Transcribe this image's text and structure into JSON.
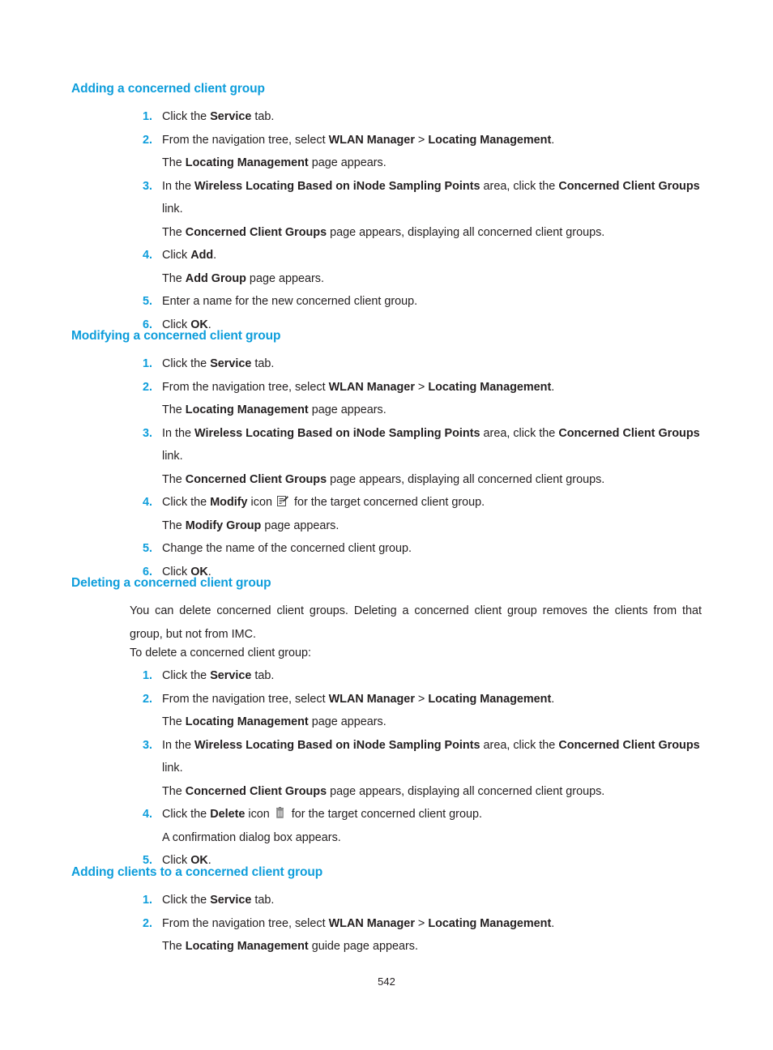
{
  "document": {
    "page_number": "542",
    "accent_color": "#0d9ddb",
    "text_color": "#231f20"
  },
  "sections": {
    "adding": {
      "heading": "Adding a concerned client group",
      "steps": {
        "n1": "1.",
        "s1_a": "Click the ",
        "s1_b": "Service",
        "s1_c": " tab.",
        "n2": "2.",
        "s2_a": "From the navigation tree, select ",
        "s2_b": "WLAN Manager",
        "s2_c": " > ",
        "s2_d": "Locating Management",
        "s2_e": ".",
        "s2_sub_a": "The ",
        "s2_sub_b": "Locating Management",
        "s2_sub_c": " page appears.",
        "n3": "3.",
        "s3_a": "In the ",
        "s3_b": "Wireless Locating Based on iNode Sampling Points",
        "s3_c": " area, click the ",
        "s3_d": "Concerned Client Groups",
        "s3_e": " link.",
        "s3_sub_a": "The ",
        "s3_sub_b": "Concerned Client Groups",
        "s3_sub_c": " page appears, displaying all concerned client groups.",
        "n4": "4.",
        "s4_a": "Click ",
        "s4_b": "Add",
        "s4_c": ".",
        "s4_sub_a": "The ",
        "s4_sub_b": "Add Group",
        "s4_sub_c": " page appears.",
        "n5": "5.",
        "s5_a": "Enter a name for the new concerned client group.",
        "n6": "6.",
        "s6_a": "Click ",
        "s6_b": "OK",
        "s6_c": "."
      }
    },
    "modifying": {
      "heading": "Modifying a concerned client group",
      "steps": {
        "n1": "1.",
        "s1_a": "Click the ",
        "s1_b": "Service",
        "s1_c": " tab.",
        "n2": "2.",
        "s2_a": "From the navigation tree, select ",
        "s2_b": "WLAN Manager",
        "s2_c": " > ",
        "s2_d": "Locating Management",
        "s2_e": ".",
        "s2_sub_a": "The ",
        "s2_sub_b": "Locating Management",
        "s2_sub_c": " page appears.",
        "n3": "3.",
        "s3_a": "In the ",
        "s3_b": "Wireless Locating Based on iNode Sampling Points",
        "s3_c": " area, click the ",
        "s3_d": "Concerned Client Groups",
        "s3_e": " link.",
        "s3_sub_a": "The ",
        "s3_sub_b": "Concerned Client Groups",
        "s3_sub_c": " page appears, displaying all concerned client groups.",
        "n4": "4.",
        "s4_a": "Click the ",
        "s4_b": "Modify",
        "s4_c": " icon ",
        "s4_icon": "modify-icon",
        "s4_d": " for the target concerned client group.",
        "s4_sub_a": "The ",
        "s4_sub_b": "Modify Group",
        "s4_sub_c": " page appears.",
        "n5": "5.",
        "s5_a": "Change the name of the concerned client group.",
        "n6": "6.",
        "s6_a": "Click ",
        "s6_b": "OK",
        "s6_c": "."
      }
    },
    "deleting": {
      "heading": "Deleting a concerned client group",
      "intro": "You can delete concerned client groups. Deleting a concerned client group removes the clients from that group, but not from IMC.",
      "lead_in": "To delete a concerned client group:",
      "steps": {
        "n1": "1.",
        "s1_a": "Click the ",
        "s1_b": "Service",
        "s1_c": " tab.",
        "n2": "2.",
        "s2_a": "From the navigation tree, select ",
        "s2_b": "WLAN Manager",
        "s2_c": " > ",
        "s2_d": "Locating Management",
        "s2_e": ".",
        "s2_sub_a": "The ",
        "s2_sub_b": "Locating Management",
        "s2_sub_c": " page appears.",
        "n3": "3.",
        "s3_a": "In the ",
        "s3_b": "Wireless Locating Based on iNode Sampling Points",
        "s3_c": " area, click the ",
        "s3_d": "Concerned Client Groups",
        "s3_e": " link.",
        "s3_sub_a": "The ",
        "s3_sub_b": "Concerned Client Groups",
        "s3_sub_c": " page appears, displaying all concerned client groups.",
        "n4": "4.",
        "s4_a": "Click the ",
        "s4_b": "Delete",
        "s4_c": " icon ",
        "s4_icon": "delete-icon",
        "s4_d": " for the target concerned client group.",
        "s4_sub_a": "A confirmation dialog box appears.",
        "n5": "5.",
        "s5_a": "Click ",
        "s5_b": "OK",
        "s5_c": "."
      }
    },
    "adding_clients": {
      "heading": "Adding clients to a concerned client group",
      "steps": {
        "n1": "1.",
        "s1_a": "Click the ",
        "s1_b": "Service",
        "s1_c": " tab.",
        "n2": "2.",
        "s2_a": "From the navigation tree, select ",
        "s2_b": "WLAN Manager",
        "s2_c": " > ",
        "s2_d": "Locating Management",
        "s2_e": ".",
        "s2_sub_a": "The ",
        "s2_sub_b": "Locating Management",
        "s2_sub_c": " guide page appears."
      }
    }
  }
}
